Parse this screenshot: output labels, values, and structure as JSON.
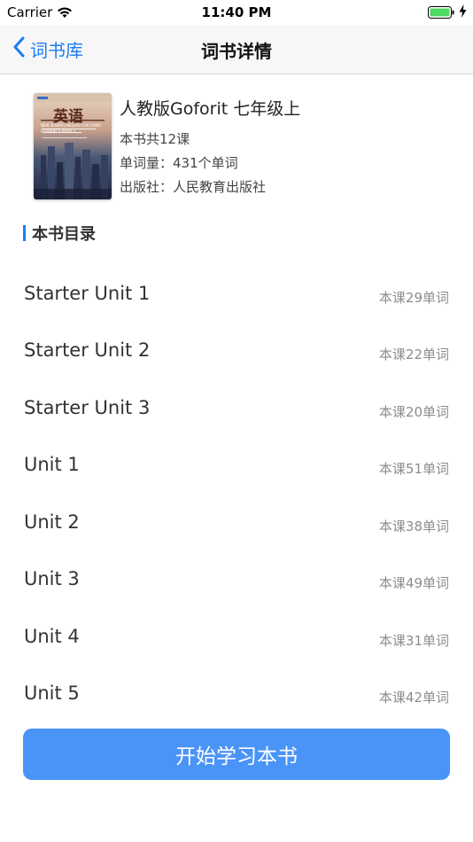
{
  "status_bar": {
    "carrier": "Carrier",
    "time": "11:40 PM"
  },
  "nav": {
    "back_label": "词书库",
    "title": "词书详情"
  },
  "book": {
    "cover_title": "英语",
    "cover_subtitle": "NEW SENIOR ENGLISH FOR CHINA",
    "cover_sub2": "STUDENT'S BOOK 1",
    "title": "人教版Goforit 七年级上",
    "lessons": "本书共12课",
    "word_count": "单词量：431个单词",
    "publisher": "出版社：人民教育出版社"
  },
  "section_title": "本书目录",
  "units": [
    {
      "name": "Starter Unit 1",
      "count": "本课29单词"
    },
    {
      "name": "Starter Unit 2",
      "count": "本课22单词"
    },
    {
      "name": "Starter Unit 3",
      "count": "本课20单词"
    },
    {
      "name": "Unit 1",
      "count": "本课51单词"
    },
    {
      "name": "Unit 2",
      "count": "本课38单词"
    },
    {
      "name": "Unit 3",
      "count": "本课49单词"
    },
    {
      "name": "Unit 4",
      "count": "本课31单词"
    },
    {
      "name": "Unit 5",
      "count": "本课42单词"
    }
  ],
  "start_button": "开始学习本书",
  "colors": {
    "accent": "#1a7cf5",
    "button": "#4a94f8",
    "battery": "#4cd964"
  }
}
